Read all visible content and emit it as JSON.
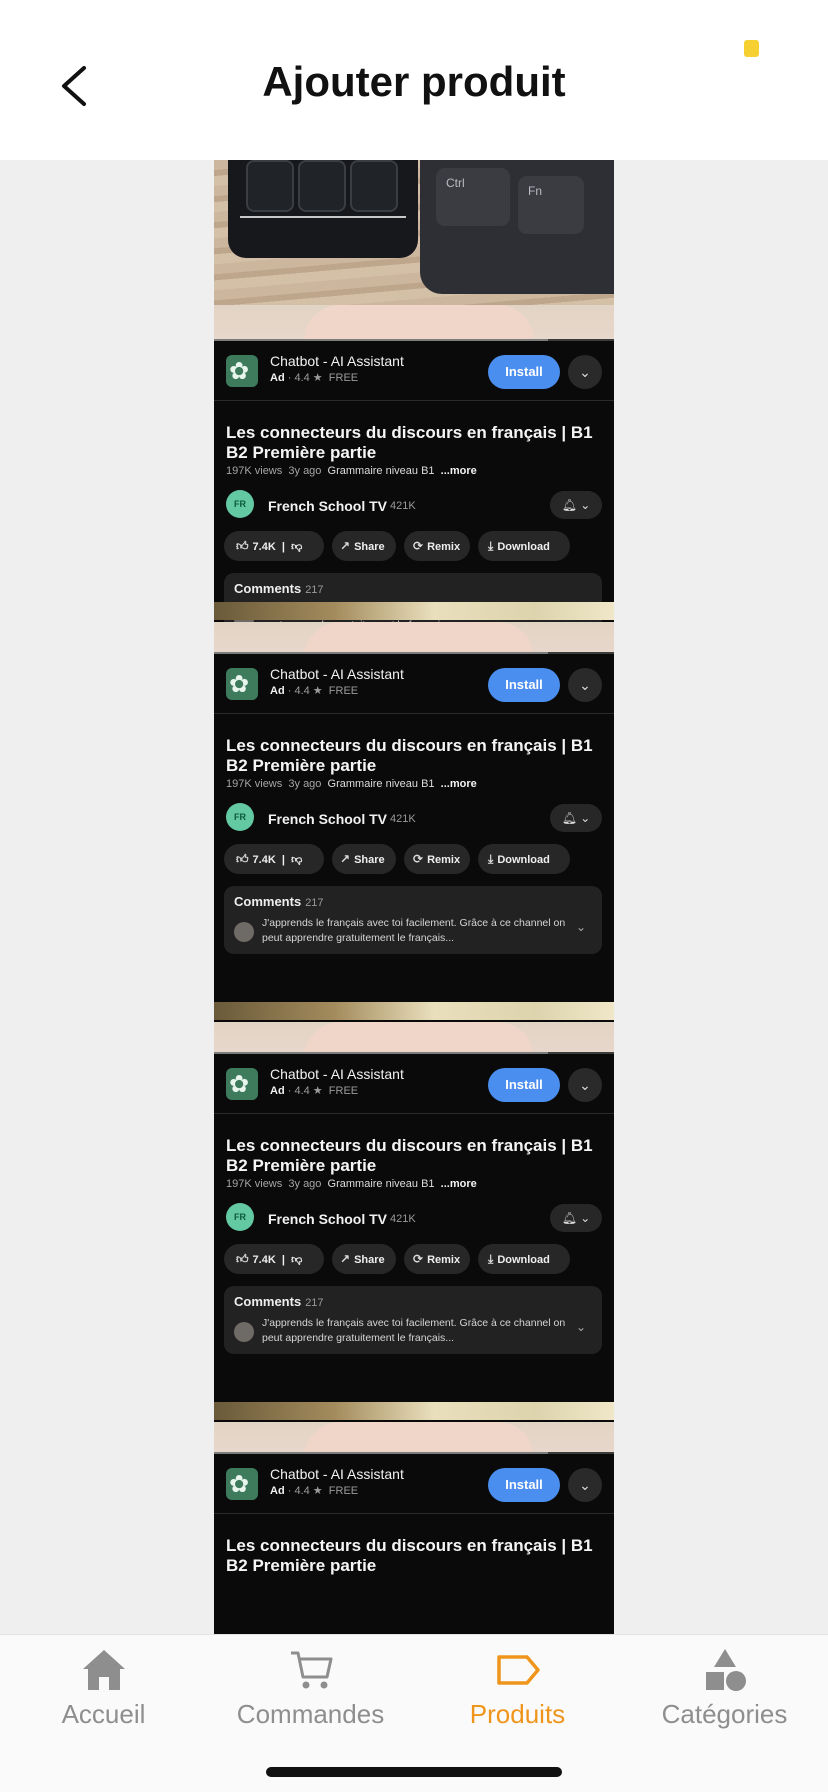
{
  "header": {
    "title": "Ajouter produit"
  },
  "ad": {
    "app_name": "Chatbot - AI Assistant",
    "ad_label": "Ad",
    "rating": "4.4",
    "price": "FREE",
    "install_label": "Install"
  },
  "video": {
    "title": "Les connecteurs du discours en français | B1 B2 Première partie",
    "views": "197K views",
    "age": "3y ago",
    "tag": "Grammaire niveau B1",
    "more": "...more",
    "channel_name": "French School TV",
    "channel_subs": "421K",
    "likes": "7.4K",
    "share": "Share",
    "remix": "Remix",
    "download": "Download",
    "comments_label": "Comments",
    "comments_count": "217",
    "top_comment": "J'apprends le français avec toi facilement. Grâce à ce channel on peut apprendre gratuitement le français..."
  },
  "keyboard_keys": {
    "ctrl": "Ctrl",
    "fn": "Fn"
  },
  "tabs": [
    {
      "label": "Accueil",
      "icon": "home-icon"
    },
    {
      "label": "Commandes",
      "icon": "cart-icon"
    },
    {
      "label": "Produits",
      "icon": "tag-icon",
      "active": true
    },
    {
      "label": "Catégories",
      "icon": "shapes-icon"
    }
  ],
  "colors": {
    "accent": "#f0951c",
    "install": "#4a8ef0",
    "status_dot": "#f5d030"
  }
}
